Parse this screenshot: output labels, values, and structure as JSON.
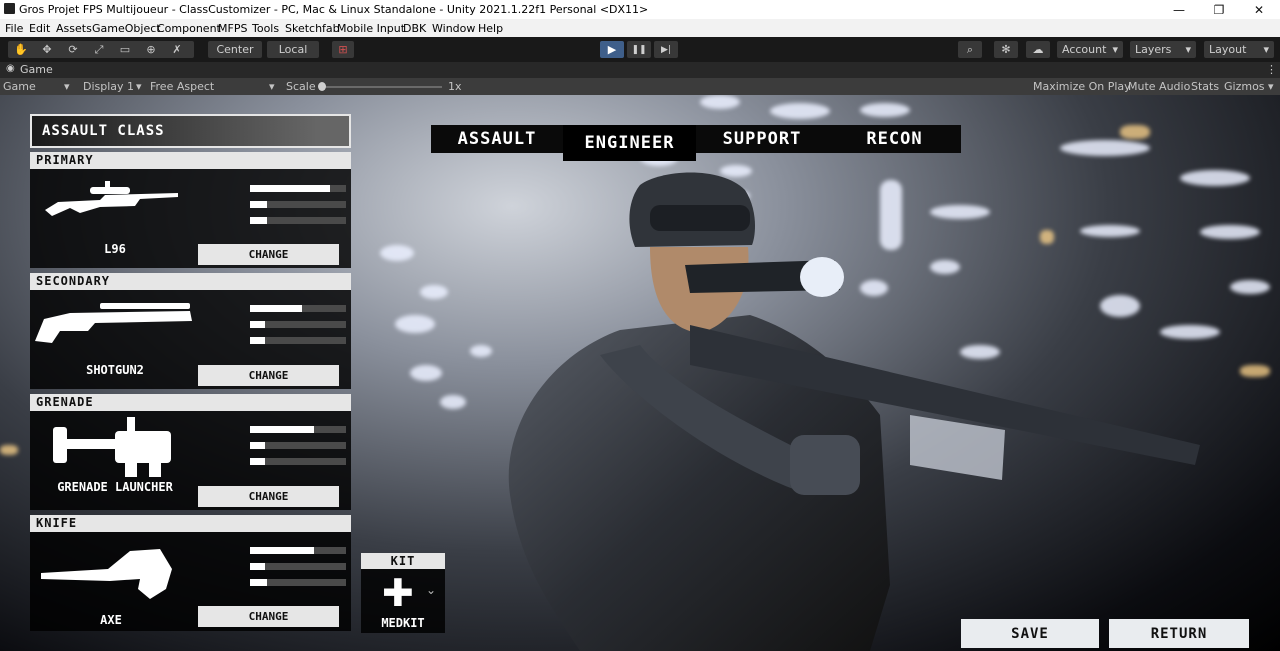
{
  "window": {
    "title": "Gros Projet FPS Multijoueur - ClassCustomizer - PC, Mac & Linux Standalone - Unity 2021.1.22f1 Personal <DX11>",
    "minimize_glyph": "—",
    "maximize_glyph": "❐",
    "close_glyph": "✕"
  },
  "menu": [
    "File",
    "Edit",
    "Assets",
    "GameObject",
    "Component",
    "MFPS",
    "Tools",
    "Sketchfab",
    "Mobile Input",
    "DBK",
    "Window",
    "Help"
  ],
  "toolbar": {
    "tool_glyphs": [
      "✋",
      "✥",
      "⟳",
      "⤢",
      "▭",
      "⊕",
      "✗"
    ],
    "pivot": "Center",
    "space": "Local",
    "snap_glyph": "⊞",
    "play_glyph": "▶",
    "pause_glyph": "❚❚",
    "step_glyph": "▶|",
    "search_glyph": "⌕",
    "services_glyph": "✻",
    "cloud_glyph": "☁",
    "account": "Account",
    "layers": "Layers",
    "layout": "Layout",
    "dropdown_glyph": "▾"
  },
  "game_tab": {
    "label": "Game",
    "menu_glyph": "⋮",
    "view_select": "Game",
    "display": "Display 1",
    "aspect": "Free Aspect",
    "scale_label": "Scale",
    "scale_value": "1x",
    "scale_level": 0,
    "options": [
      "Maximize On Play",
      "Mute Audio",
      "Stats",
      "Gizmos"
    ]
  },
  "ui": {
    "class_title": "ASSAULT CLASS",
    "tabs": [
      "ASSAULT",
      "ENGINEER",
      "SUPPORT",
      "RECON"
    ],
    "selected_tab": 1,
    "slots": [
      {
        "section": "PRIMARY",
        "weapon": "L96",
        "change": "CHANGE",
        "stats": [
          0.83,
          0.18,
          0.18
        ]
      },
      {
        "section": "SECONDARY",
        "weapon": "SHOTGUN2",
        "change": "CHANGE",
        "stats": [
          0.54,
          0.16,
          0.16
        ]
      },
      {
        "section": "GRENADE",
        "weapon": "GRENADE LAUNCHER",
        "change": "CHANGE",
        "stats": [
          0.67,
          0.16,
          0.16
        ]
      },
      {
        "section": "KNIFE",
        "weapon": "AXE",
        "change": "CHANGE",
        "stats": [
          0.67,
          0.16,
          0.18
        ]
      }
    ],
    "kit": {
      "label": "KIT",
      "item": "MEDKIT",
      "glyph": "✚",
      "chevron": "⌄"
    },
    "save": "SAVE",
    "return": "RETURN"
  },
  "colors": {
    "editor_toolbar": "#191919",
    "play_active": "#3f5f8a",
    "panel_bar": "#e6e6e6",
    "accent_button": "#e9ecef"
  }
}
